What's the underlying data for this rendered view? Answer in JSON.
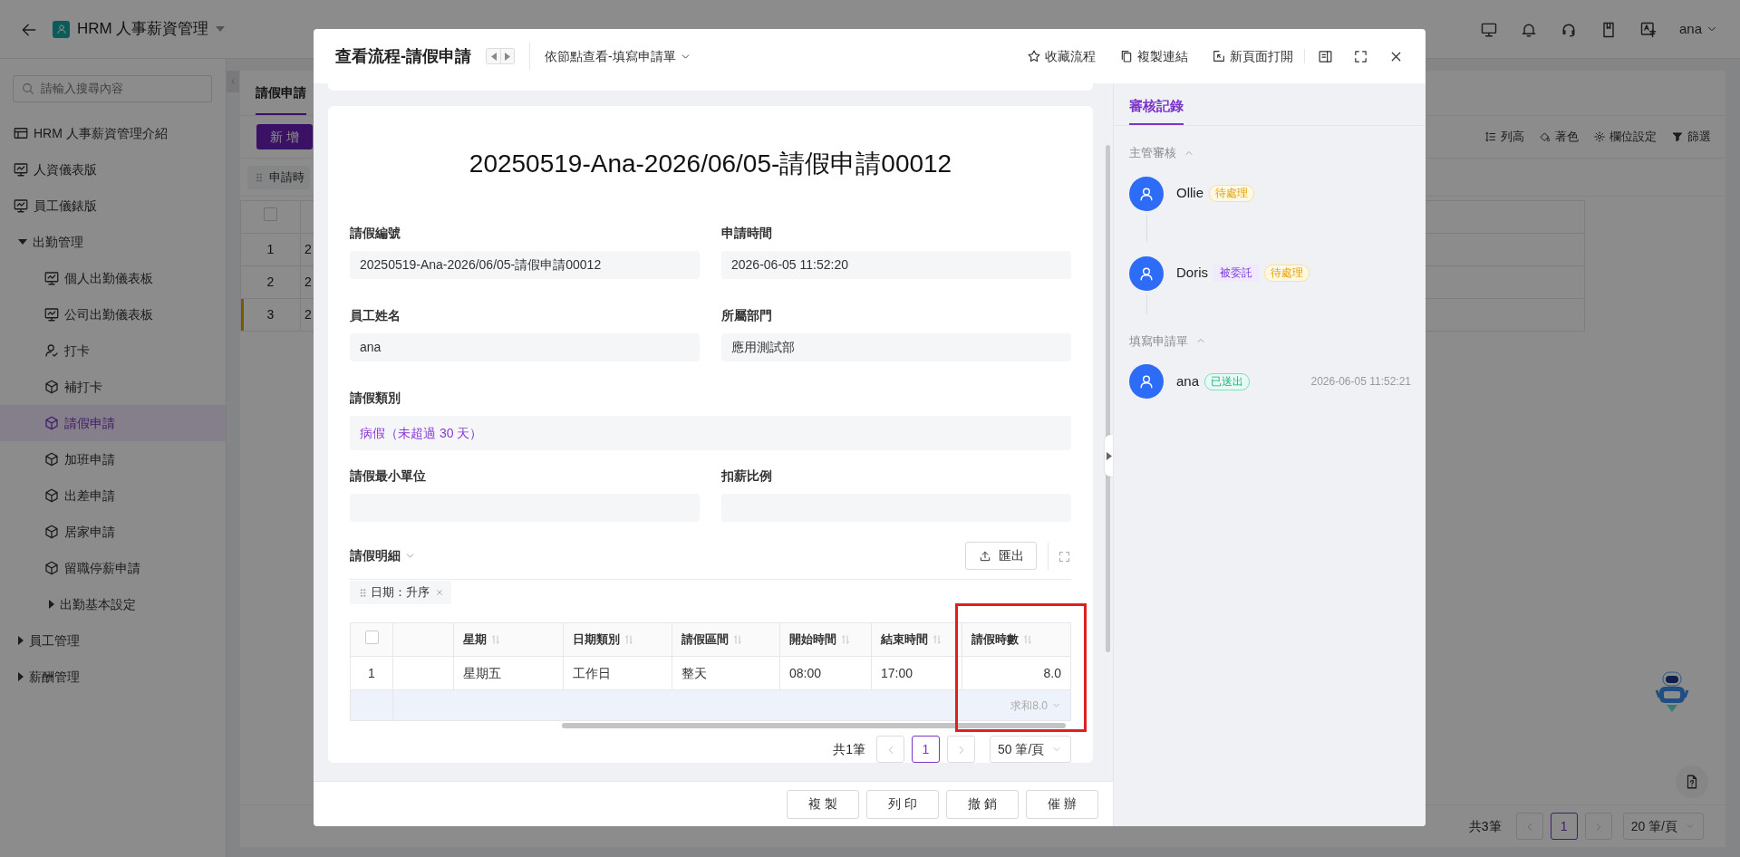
{
  "app": {
    "title": "HRM 人事薪資管理",
    "user": "ana"
  },
  "search": {
    "placeholder": "請輸入搜尋內容"
  },
  "sidebar": {
    "items": [
      {
        "label": "HRM 人事薪資管理介紹",
        "kind": "table",
        "selected": false
      },
      {
        "label": "人資儀表版",
        "kind": "dashboard",
        "selected": false
      },
      {
        "label": "員工儀錶版",
        "kind": "dashboard",
        "selected": false
      },
      {
        "label": "出勤管理",
        "kind": "group",
        "expanded": true,
        "selected": false,
        "children": [
          {
            "label": "個人出勤儀表板",
            "kind": "dashboard",
            "selected": false
          },
          {
            "label": "公司出勤儀表板",
            "kind": "dashboard",
            "selected": false
          },
          {
            "label": "打卡",
            "kind": "user",
            "selected": false
          },
          {
            "label": "補打卡",
            "kind": "cube",
            "selected": false
          },
          {
            "label": "請假申請",
            "kind": "cube",
            "selected": true
          },
          {
            "label": "加班申請",
            "kind": "cube",
            "selected": false
          },
          {
            "label": "出差申請",
            "kind": "cube",
            "selected": false
          },
          {
            "label": "居家申請",
            "kind": "cube",
            "selected": false
          },
          {
            "label": "留職停薪申請",
            "kind": "cube",
            "selected": false
          },
          {
            "label": "出勤基本設定",
            "kind": "group",
            "expanded": false,
            "selected": false
          }
        ]
      },
      {
        "label": "員工管理",
        "kind": "group",
        "expanded": false,
        "selected": false
      },
      {
        "label": "薪酬管理",
        "kind": "group",
        "expanded": false,
        "selected": false
      }
    ]
  },
  "page": {
    "tabs": [
      {
        "label": "請假申請",
        "selected": true
      }
    ],
    "add_button": "新 增",
    "toolbar": [
      {
        "label": "列高",
        "kind": "rows"
      },
      {
        "label": "著色",
        "kind": "paint"
      },
      {
        "label": "欄位設定",
        "kind": "gear"
      },
      {
        "label": "篩選",
        "kind": "filter"
      }
    ],
    "sort_chip": "申請時",
    "select_all": {
      "checked": false
    },
    "rows": [
      {
        "index": "1",
        "cell": "2",
        "selected": false
      },
      {
        "index": "2",
        "cell": "2",
        "selected": false
      },
      {
        "index": "3",
        "cell": "2",
        "selected": true
      }
    ],
    "pagination": {
      "total": "共3筆",
      "page": "1",
      "page_size": "20 筆/頁"
    }
  },
  "dialog": {
    "title": "查看流程-請假申請",
    "view_select": "依節點查看-填寫申請單",
    "actions": [
      {
        "label": "收藏流程",
        "kind": "star"
      },
      {
        "label": "複製連結",
        "kind": "copy"
      },
      {
        "label": "新頁面打開",
        "kind": "open"
      }
    ],
    "form": {
      "heading": "20250519-Ana-2026/06/05-請假申請00012",
      "fields": [
        {
          "label": "請假編號",
          "value": "20250519-Ana-2026/06/05-請假申請00012",
          "kind": "text"
        },
        {
          "label": "申請時間",
          "value": "2026-06-05 11:52:20",
          "kind": "text"
        },
        {
          "label": "員工姓名",
          "value": "ana",
          "kind": "text"
        },
        {
          "label": "所屬部門",
          "value": "應用測試部",
          "kind": "text"
        },
        {
          "label": "請假類別",
          "value": "病假（未超過 30 天）",
          "kind": "option"
        },
        {
          "label": "請假最小單位",
          "kind": "text"
        },
        {
          "label": "扣薪比例",
          "kind": "text"
        }
      ]
    },
    "detail": {
      "title": "請假明細",
      "export_button": "匯出",
      "sort_tag": "日期：升序",
      "select_all": {
        "checked": false
      },
      "columns": [
        {
          "label": "星期",
          "highlighted": false
        },
        {
          "label": "日期類別",
          "highlighted": false
        },
        {
          "label": "請假區間",
          "highlighted": false
        },
        {
          "label": "開始時間",
          "highlighted": false
        },
        {
          "label": "結束時間",
          "highlighted": false
        },
        {
          "label": "請假時數",
          "highlighted": true
        }
      ],
      "rows": [
        {
          "index": "1",
          "cells": [
            "星期五",
            "工作日",
            "整天",
            "08:00",
            "17:00",
            "8.0"
          ]
        }
      ],
      "summary": "求和8.0",
      "pagination": {
        "total": "共1筆",
        "page": "1",
        "page_size": "50 筆/頁"
      }
    },
    "footer_buttons": [
      "複 製",
      "列 印",
      "撤 銷",
      "催 辦"
    ],
    "review": {
      "tab": "審核記錄",
      "groups": [
        {
          "title": "主管審核",
          "expanded": true,
          "entries": [
            {
              "name": "Ollie",
              "tags": [
                {
                  "label": "待處理",
                  "kind": "pending"
                }
              ]
            },
            {
              "name": "Doris",
              "tags": [
                {
                  "label": "被委託",
                  "kind": "delegated"
                },
                {
                  "label": "待處理",
                  "kind": "pending"
                }
              ]
            }
          ]
        },
        {
          "title": "填寫申請單",
          "expanded": true,
          "entries": [
            {
              "name": "ana",
              "tags": [
                {
                  "label": "已送出",
                  "kind": "done"
                }
              ],
              "time": "2026-06-05 11:52:21"
            }
          ]
        }
      ]
    }
  }
}
